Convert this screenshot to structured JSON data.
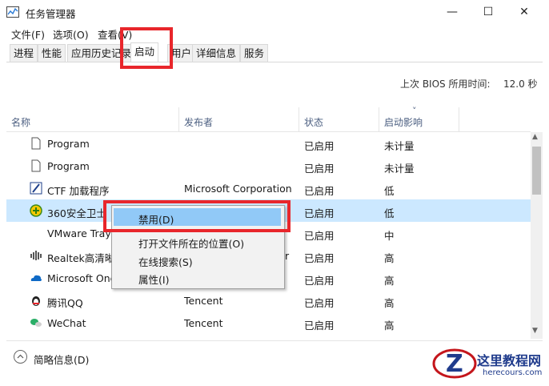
{
  "window": {
    "title": "任务管理器",
    "minimize_glyph": "—",
    "maximize_glyph": "☐",
    "close_glyph": "✕"
  },
  "menu": {
    "file": "文件(F)",
    "options": "选项(O)",
    "view": "查看(V)"
  },
  "tabs": [
    {
      "label": "进程"
    },
    {
      "label": "性能"
    },
    {
      "label": "应用历史记录"
    },
    {
      "label": "启动",
      "active": true
    },
    {
      "label": "用户"
    },
    {
      "label": "详细信息"
    },
    {
      "label": "服务"
    }
  ],
  "bios": {
    "label": "上次 BIOS 所用时间:",
    "value": "12.0 秒"
  },
  "columns": {
    "name": "名称",
    "publisher": "发布者",
    "status": "状态",
    "impact": "启动影响",
    "sort_glyph": "˅"
  },
  "rows": [
    {
      "name": "Program",
      "publisher": "",
      "status": "已启用",
      "impact": "未计量",
      "icon": "blank-file-icon"
    },
    {
      "name": "Program",
      "publisher": "",
      "status": "已启用",
      "impact": "未计量",
      "icon": "blank-file-icon"
    },
    {
      "name": "CTF 加载程序",
      "publisher": "Microsoft Corporation",
      "status": "已启用",
      "impact": "低",
      "icon": "ctf-pen-icon"
    },
    {
      "name": "360安全卫士",
      "publisher": "",
      "status": "已启用",
      "impact": "低",
      "icon": "360-shield-icon",
      "selected": true
    },
    {
      "name": "VMware Tray",
      "publisher": "",
      "status": "已启用",
      "impact": "中",
      "icon": "none"
    },
    {
      "name": "Realtek高清晰",
      "publisher": "r",
      "status": "已启用",
      "impact": "高",
      "icon": "realtek-audio-icon"
    },
    {
      "name": "Microsoft One",
      "publisher": "",
      "status": "已启用",
      "impact": "高",
      "icon": "onedrive-cloud-icon"
    },
    {
      "name": "腾讯QQ",
      "publisher": "Tencent",
      "status": "已启用",
      "impact": "高",
      "icon": "qq-penguin-icon"
    },
    {
      "name": "WeChat",
      "publisher": "Tencent",
      "status": "已启用",
      "impact": "高",
      "icon": "wechat-icon"
    }
  ],
  "context_menu": {
    "disable": "禁用(D)",
    "open_location": "打开文件所在的位置(O)",
    "search_online": "在线搜索(S)",
    "properties": "属性(I)"
  },
  "footer": {
    "fewer_details": "简略信息(D)"
  },
  "watermark": {
    "title": "这里教程网",
    "url": "herecours.com"
  },
  "colors": {
    "accent_red": "#e8262b",
    "selection": "#cce8ff",
    "menu_highlight": "#91c9f7",
    "header_text": "#4d6082"
  }
}
